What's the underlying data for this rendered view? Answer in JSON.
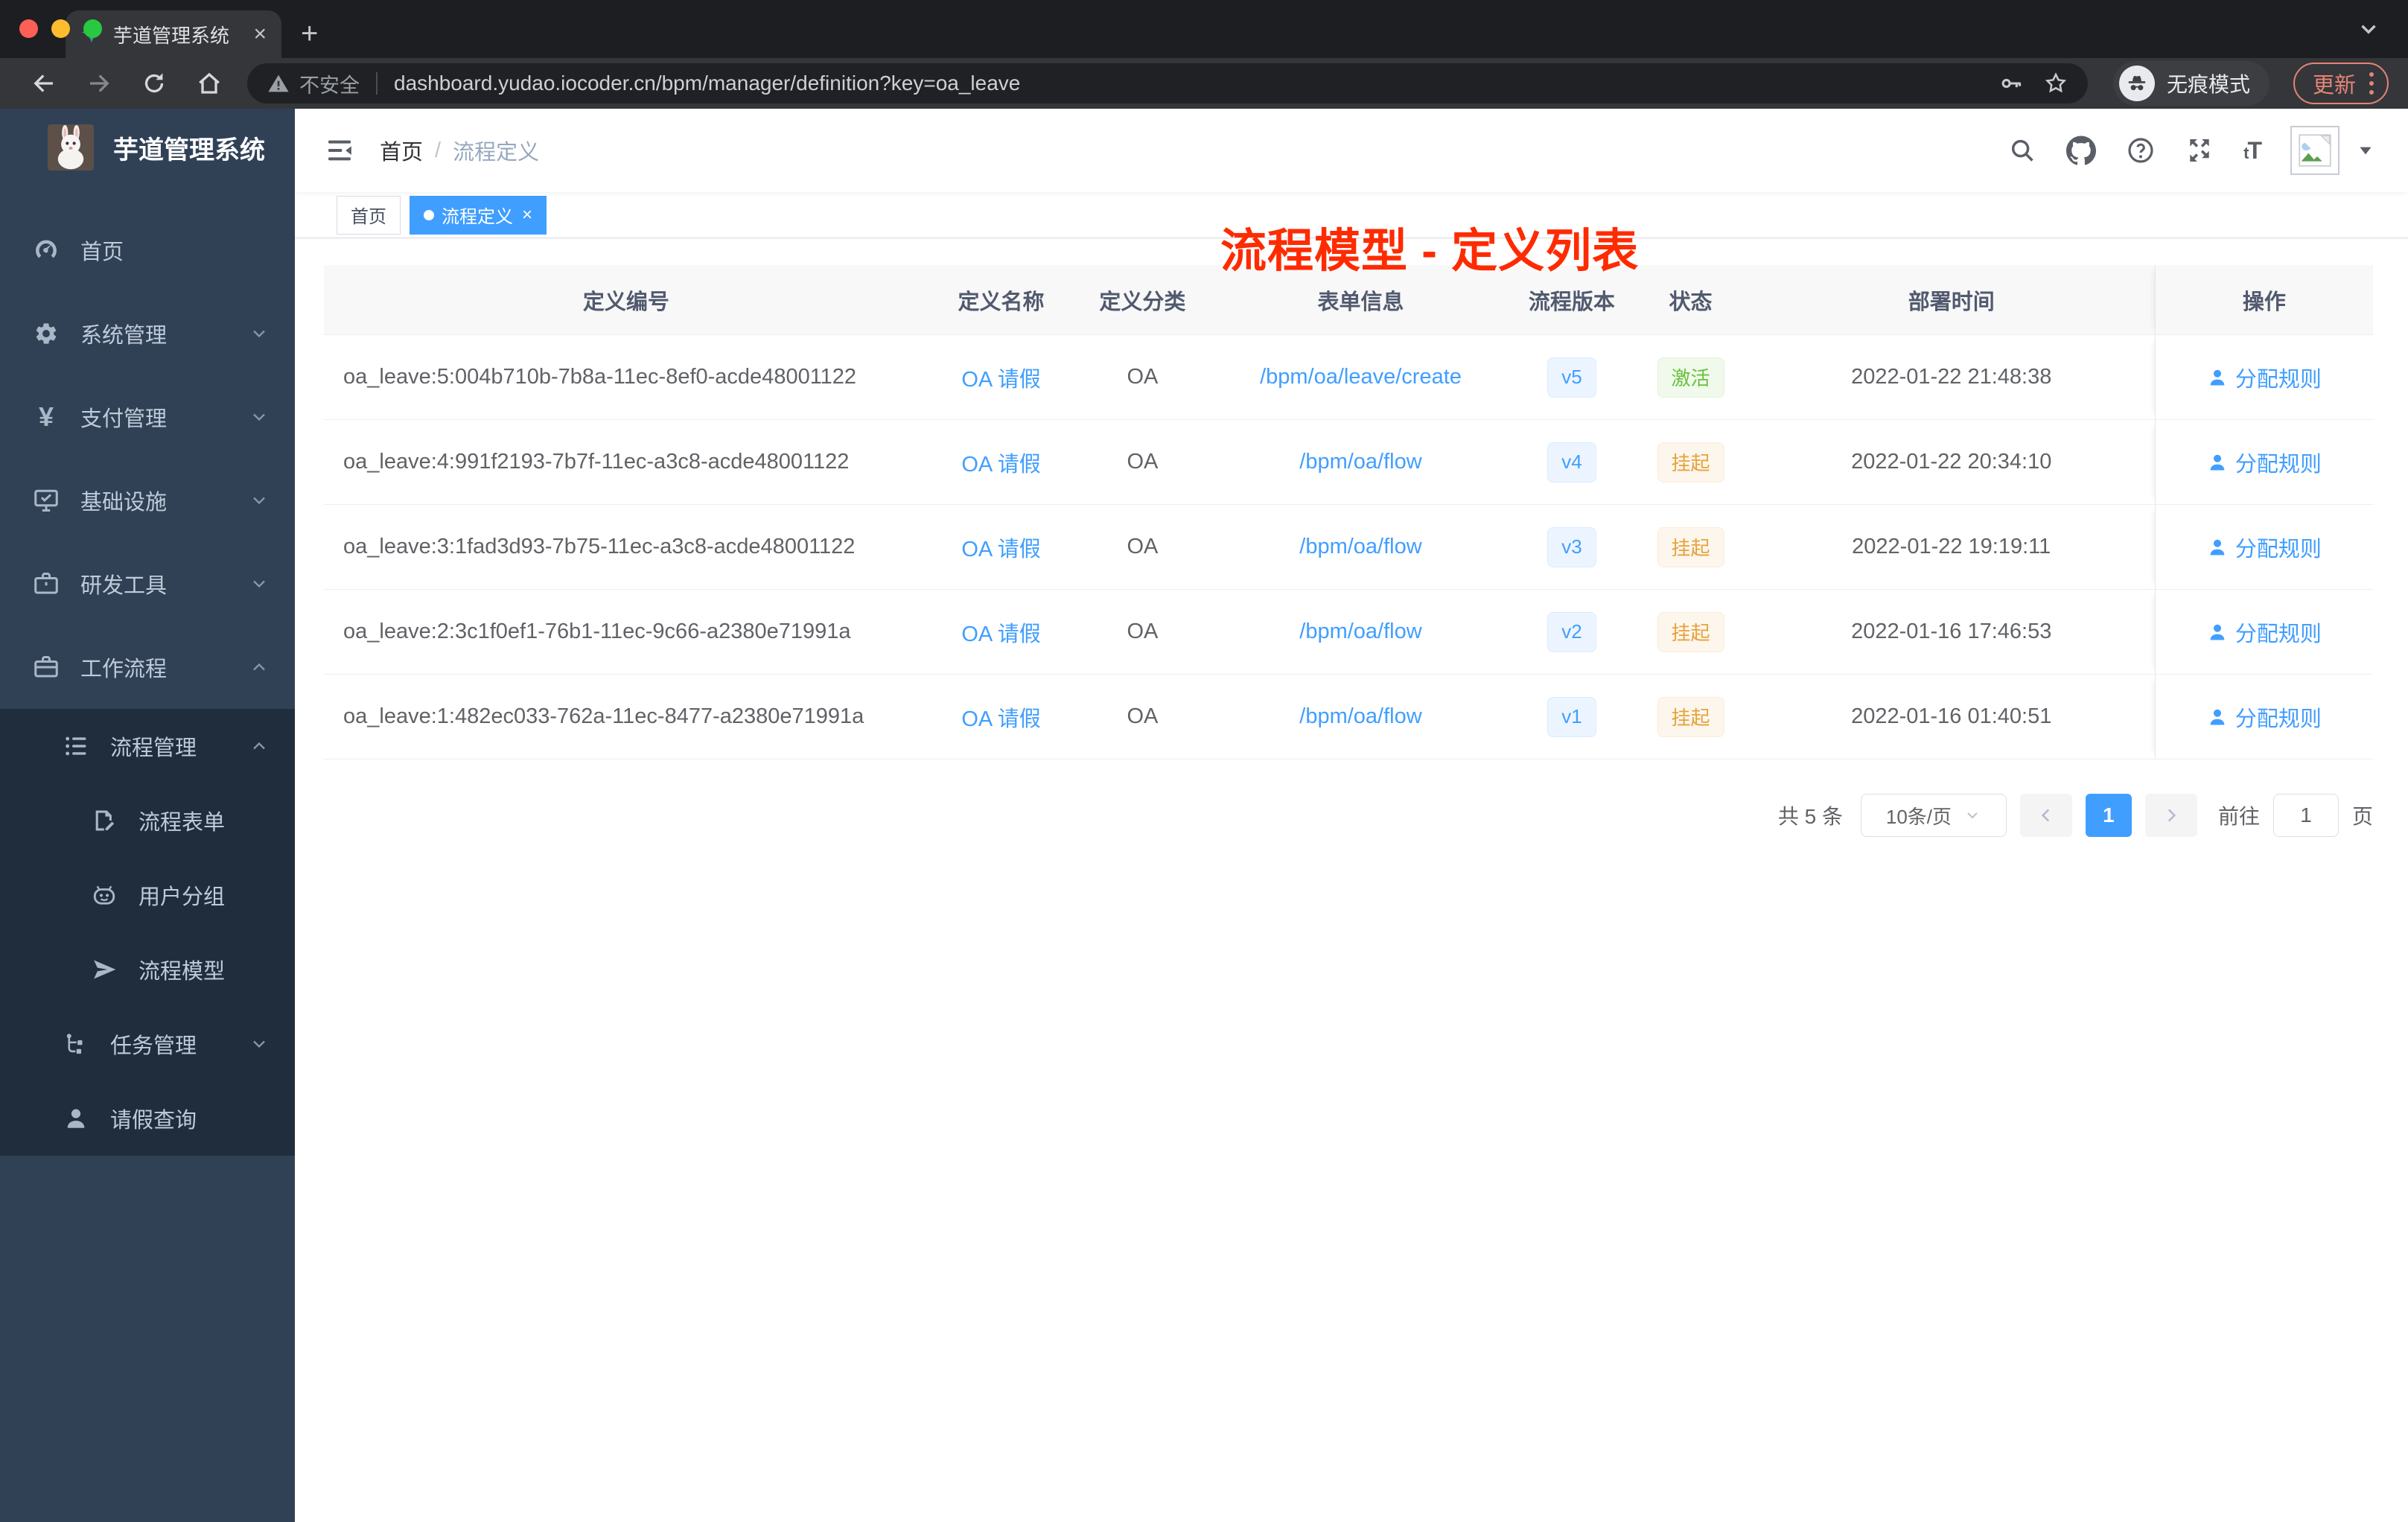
{
  "browser": {
    "tab": {
      "title": "芋道管理系统",
      "close_glyph": "×",
      "new_tab_glyph": "+"
    },
    "security_label": "不安全",
    "url": "dashboard.yudao.iocoder.cn/bpm/manager/definition?key=oa_leave",
    "incognito_label": "无痕模式",
    "update_label": "更新"
  },
  "sidebar": {
    "logo_title": "芋道管理系统",
    "items": [
      {
        "label": "首页",
        "icon": "dashboard-icon",
        "level": 1,
        "sub": false,
        "chevron": ""
      },
      {
        "label": "系统管理",
        "icon": "gear-icon",
        "level": 1,
        "sub": false,
        "chevron": "down"
      },
      {
        "label": "支付管理",
        "icon": "yen-icon",
        "level": 1,
        "sub": false,
        "chevron": "down"
      },
      {
        "label": "基础设施",
        "icon": "monitor-icon",
        "level": 1,
        "sub": false,
        "chevron": "down"
      },
      {
        "label": "研发工具",
        "icon": "toolbox-icon",
        "level": 1,
        "sub": false,
        "chevron": "down"
      },
      {
        "label": "工作流程",
        "icon": "briefcase-icon",
        "level": 1,
        "sub": false,
        "chevron": "up"
      },
      {
        "label": "流程管理",
        "icon": "list-icon",
        "level": 2,
        "sub": true,
        "chevron": "up"
      },
      {
        "label": "流程表单",
        "icon": "form-icon",
        "level": 3,
        "sub": true,
        "chevron": ""
      },
      {
        "label": "用户分组",
        "icon": "robot-icon",
        "level": 3,
        "sub": true,
        "chevron": ""
      },
      {
        "label": "流程模型",
        "icon": "paper-plane-icon",
        "level": 3,
        "sub": true,
        "chevron": ""
      },
      {
        "label": "任务管理",
        "icon": "tree-icon",
        "level": 2,
        "sub": true,
        "chevron": "down"
      },
      {
        "label": "请假查询",
        "icon": "user-icon",
        "level": 2,
        "sub": true,
        "chevron": ""
      }
    ]
  },
  "navbar": {
    "breadcrumb": [
      "首页",
      "流程定义"
    ],
    "separator": "/",
    "annotation": "流程模型 - 定义列表"
  },
  "tags": [
    {
      "label": "首页",
      "active": false
    },
    {
      "label": "流程定义",
      "active": true,
      "close_glyph": "×"
    }
  ],
  "table": {
    "headers": [
      "定义编号",
      "定义名称",
      "定义分类",
      "表单信息",
      "流程版本",
      "状态",
      "部署时间",
      "操作"
    ],
    "action_label": "分配规则",
    "rows": [
      {
        "id": "oa_leave:5:004b710b-7b8a-11ec-8ef0-acde48001122",
        "name": "OA 请假",
        "category": "OA",
        "form": "/bpm/oa/leave/create",
        "version": "v5",
        "status": "激活",
        "status_type": "success",
        "deployed": "2022-01-22 21:48:38"
      },
      {
        "id": "oa_leave:4:991f2193-7b7f-11ec-a3c8-acde48001122",
        "name": "OA 请假",
        "category": "OA",
        "form": "/bpm/oa/flow",
        "version": "v4",
        "status": "挂起",
        "status_type": "warning",
        "deployed": "2022-01-22 20:34:10"
      },
      {
        "id": "oa_leave:3:1fad3d93-7b75-11ec-a3c8-acde48001122",
        "name": "OA 请假",
        "category": "OA",
        "form": "/bpm/oa/flow",
        "version": "v3",
        "status": "挂起",
        "status_type": "warning",
        "deployed": "2022-01-22 19:19:11"
      },
      {
        "id": "oa_leave:2:3c1f0ef1-76b1-11ec-9c66-a2380e71991a",
        "name": "OA 请假",
        "category": "OA",
        "form": "/bpm/oa/flow",
        "version": "v2",
        "status": "挂起",
        "status_type": "warning",
        "deployed": "2022-01-16 17:46:53"
      },
      {
        "id": "oa_leave:1:482ec033-762a-11ec-8477-a2380e71991a",
        "name": "OA 请假",
        "category": "OA",
        "form": "/bpm/oa/flow",
        "version": "v1",
        "status": "挂起",
        "status_type": "warning",
        "deployed": "2022-01-16 01:40:51"
      }
    ]
  },
  "pagination": {
    "total": "共 5 条",
    "page_size": "10条/页",
    "current": "1",
    "goto_label": "前往",
    "goto_value": "1",
    "page_label": "页"
  },
  "colors": {
    "primary": "#409eff",
    "success": "#67c23a",
    "warning": "#e6a23c",
    "sidebar": "#304156",
    "submenu": "#1f2d3d",
    "annotation": "#fe2b01"
  }
}
